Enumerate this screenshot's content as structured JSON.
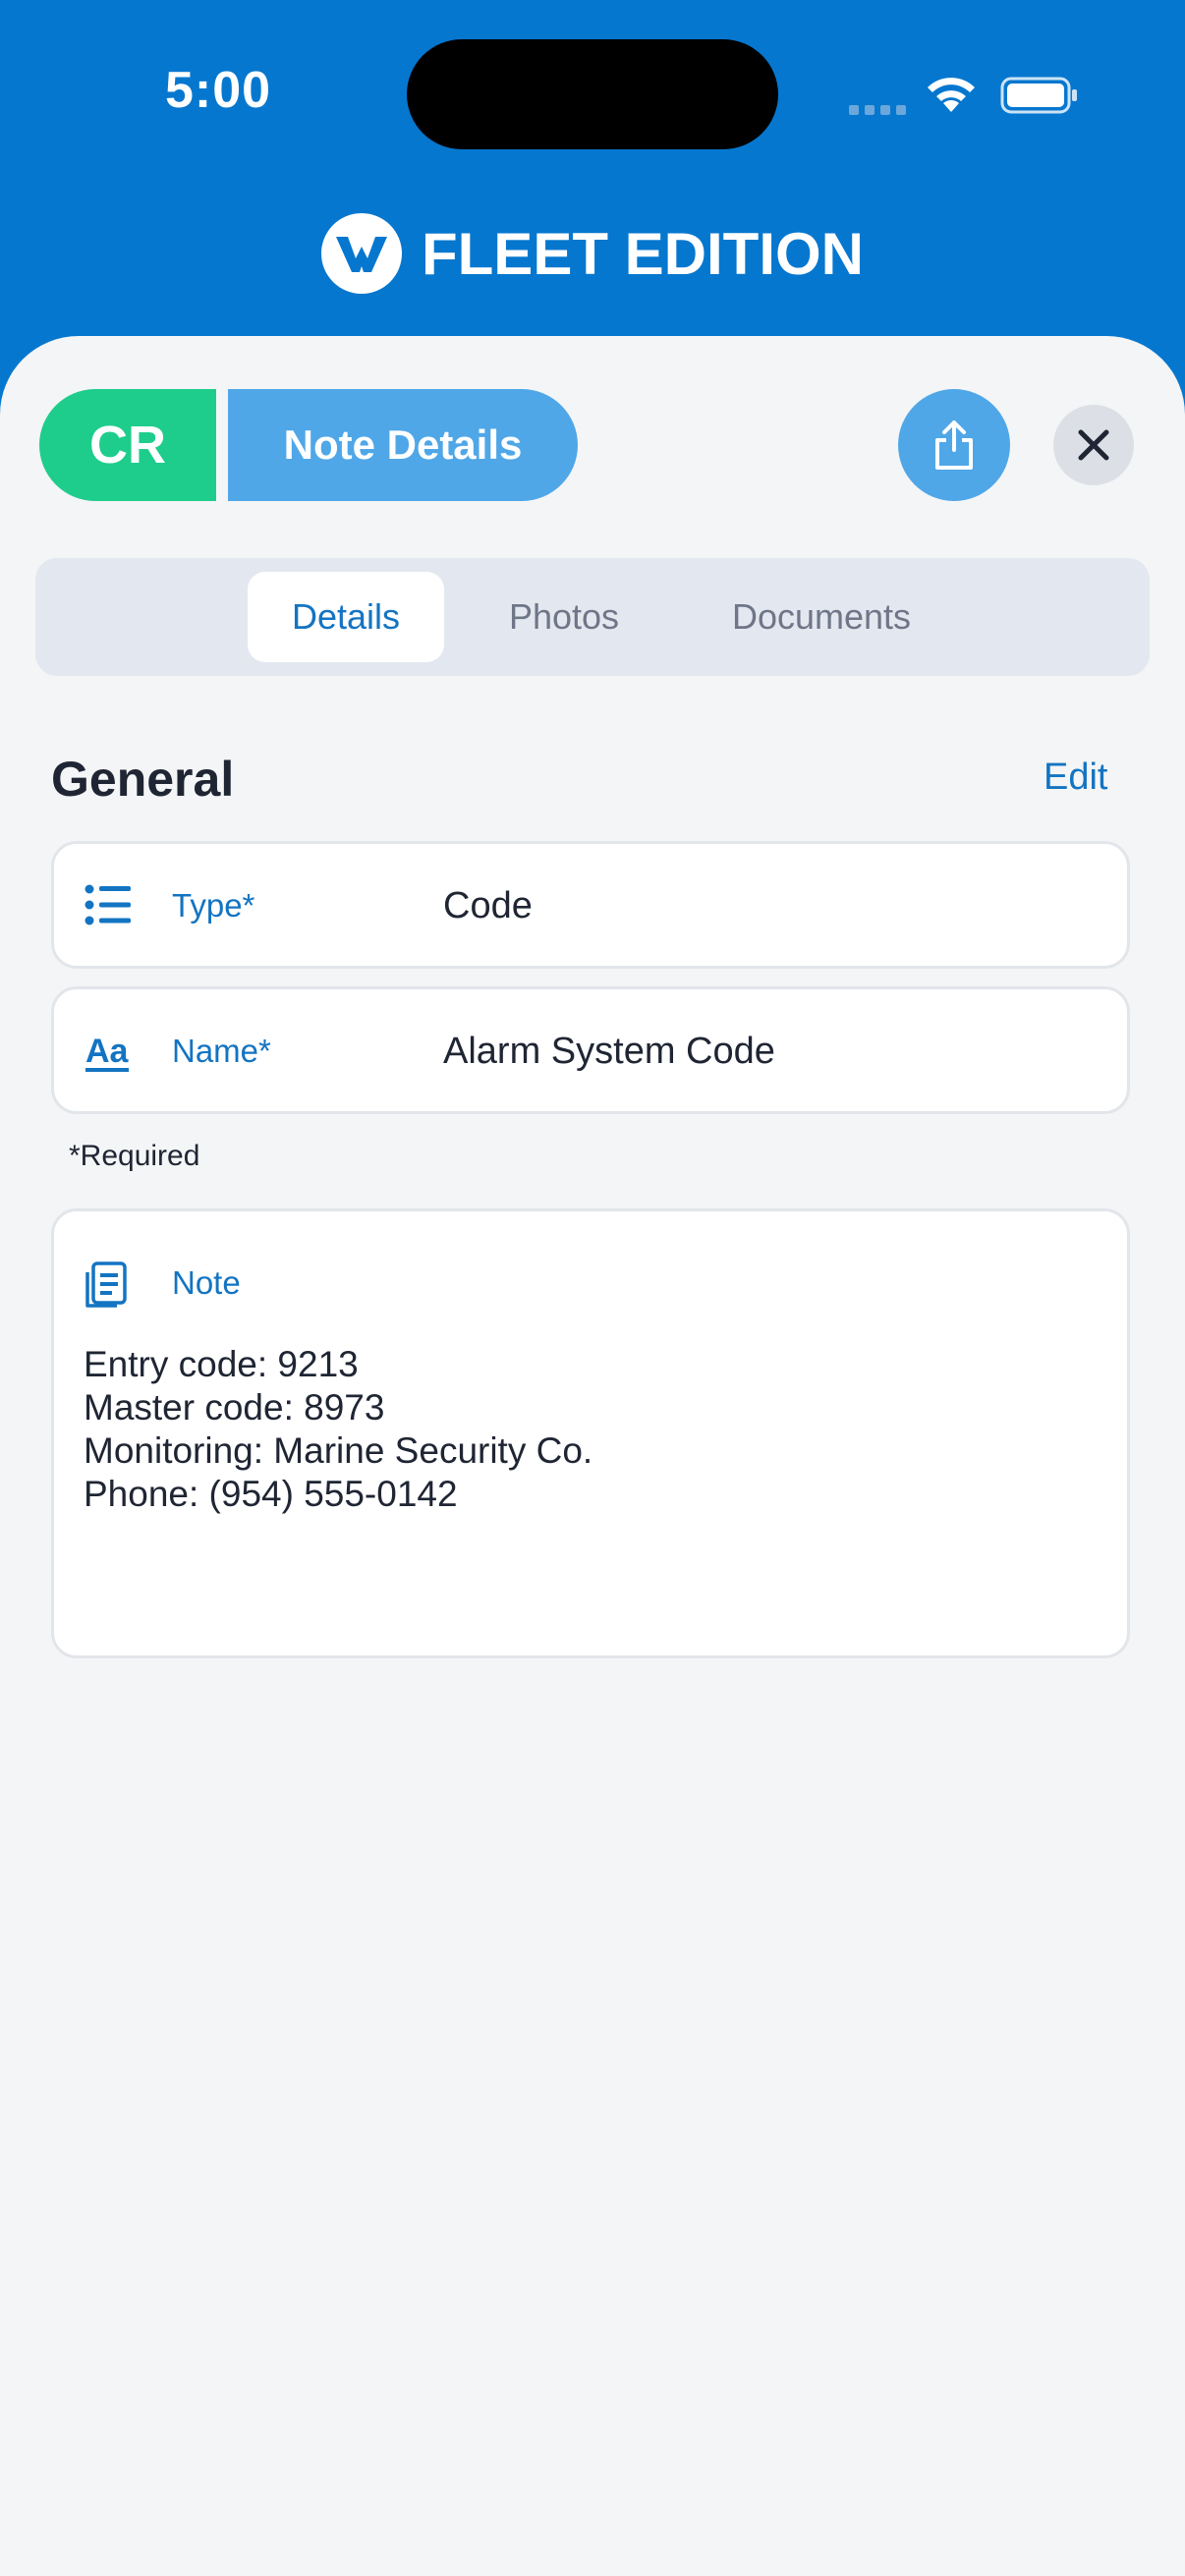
{
  "status_bar": {
    "time": "5:00"
  },
  "brand": {
    "name": "FLEET EDITION"
  },
  "header": {
    "badge": "CR",
    "title": "Note Details"
  },
  "tabs": [
    {
      "label": "Details",
      "active": true
    },
    {
      "label": "Photos",
      "active": false
    },
    {
      "label": "Documents",
      "active": false
    }
  ],
  "section": {
    "title": "General",
    "edit_label": "Edit"
  },
  "fields": {
    "type": {
      "label": "Type*",
      "value": "Code",
      "icon": "list-icon"
    },
    "name": {
      "label": "Name*",
      "value": "Alarm System Code",
      "icon": "text-format-icon"
    }
  },
  "required_note": "*Required",
  "note": {
    "label": "Note",
    "icon": "document-icon",
    "lines": [
      "Entry code: 9213",
      "Master code: 8973",
      "Monitoring: Marine Security Co.",
      "Phone: (954) 555-0142"
    ]
  },
  "colors": {
    "header_blue": "#0677CF",
    "accent_green": "#1ECD8C",
    "accent_light_blue": "#4FA7E8",
    "link_blue": "#1374C2"
  }
}
